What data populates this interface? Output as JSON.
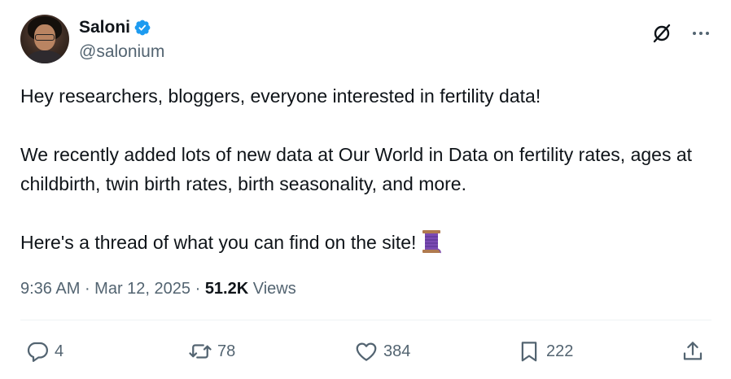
{
  "author": {
    "display_name": "Saloni",
    "handle": "@salonium",
    "verified": true,
    "verified_color": "#1d9bf0"
  },
  "tweet": {
    "paragraphs": [
      "Hey researchers, bloggers, everyone interested in fertility data!",
      "We recently added lots of new data at Our World in Data on fertility rates, ages at childbirth, twin birth rates, birth seasonality, and more.",
      "Here's a thread of what you can find on the site!"
    ],
    "emoji_icon": "thread-spool-icon"
  },
  "meta": {
    "time": "9:36 AM",
    "separator": " · ",
    "date": "Mar 12, 2025",
    "views_count": "51.2K",
    "views_label": " Views"
  },
  "actions": {
    "replies": "4",
    "reposts": "78",
    "likes": "384",
    "bookmarks": "222"
  },
  "icons": {
    "grok": "grok-icon",
    "more": "more-icon",
    "reply": "reply-icon",
    "repost": "repost-icon",
    "like": "heart-icon",
    "bookmark": "bookmark-icon",
    "share": "share-icon"
  }
}
